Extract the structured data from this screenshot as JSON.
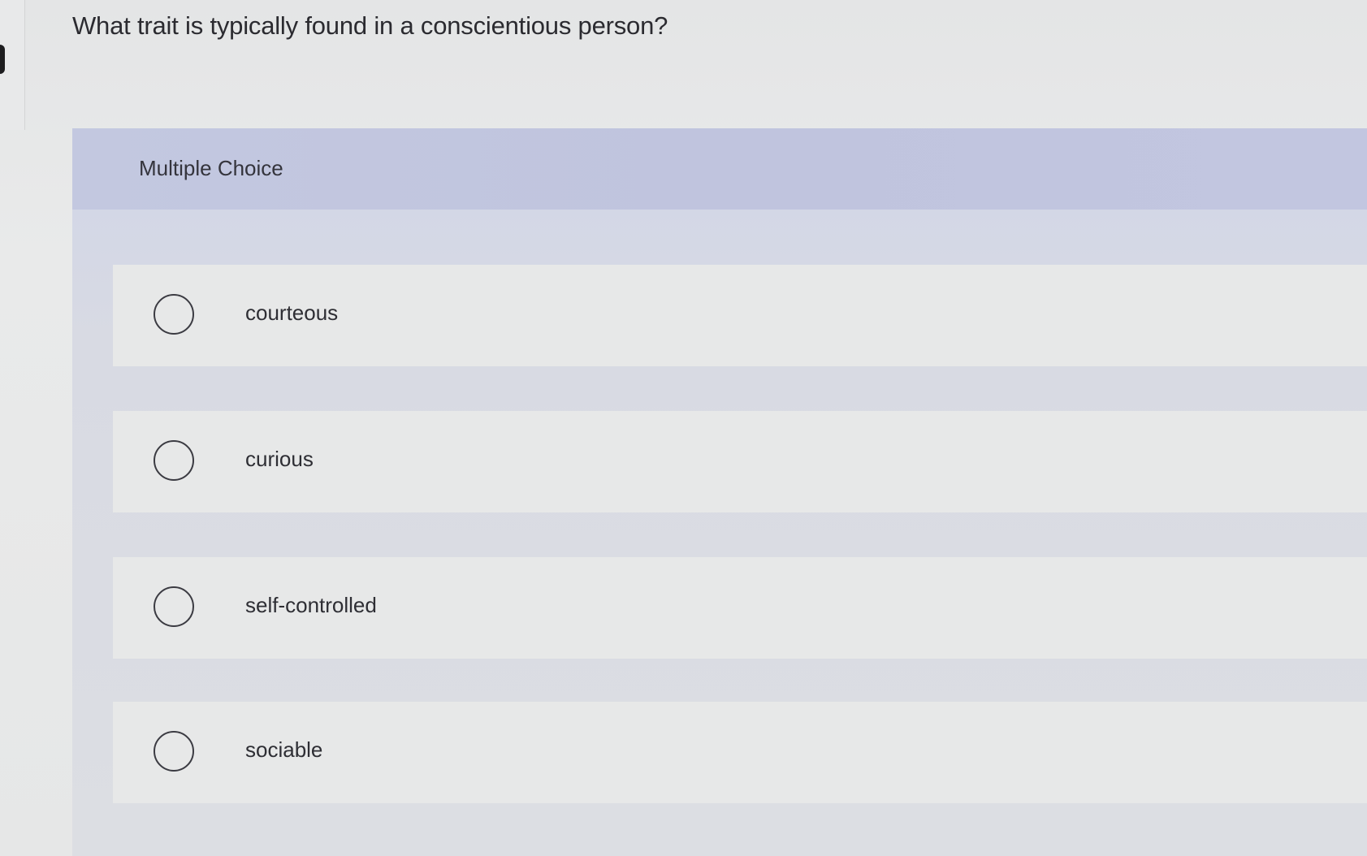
{
  "question": {
    "text": "What trait is typically found in a conscientious person?"
  },
  "question_type": {
    "label": "Multiple Choice"
  },
  "choices": [
    {
      "label": "courteous",
      "selected": false
    },
    {
      "label": "curious",
      "selected": false
    },
    {
      "label": "self-controlled",
      "selected": false
    },
    {
      "label": "sociable",
      "selected": false
    }
  ],
  "icons": {
    "radio": "radio-unselected-icon"
  },
  "colors": {
    "question_type_bar": "#c2c6e0",
    "choice_background": "#e7e8e8",
    "page_background": "#e6e7e7",
    "text": "#2b2b30"
  }
}
